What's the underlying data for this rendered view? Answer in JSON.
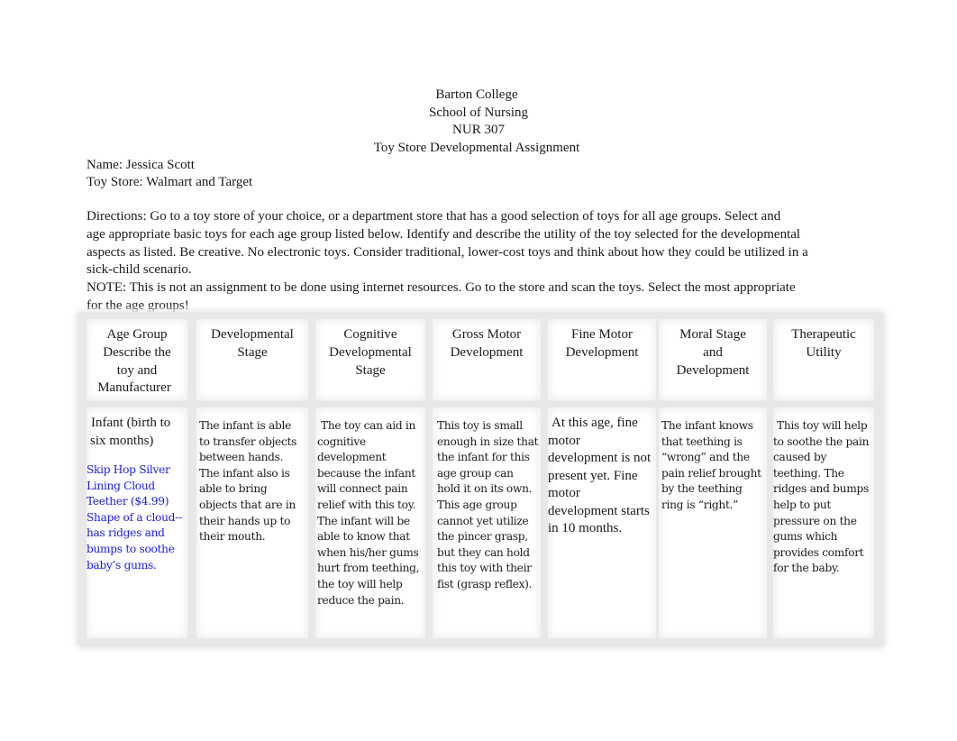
{
  "header": {
    "institution": "Barton College",
    "school": "School of Nursing",
    "course": "NUR 307",
    "assignment_title": "Toy Store Developmental Assignment"
  },
  "meta": {
    "name": "Name: Jessica Scott",
    "toy_store": "Toy Store: Walmart and Target"
  },
  "directions": {
    "line1": "Directions: Go to a toy store of your choice, or a department store that has a good selection of toys for all age groups. Select and",
    "line2": "age appropriate basic toys for each age group listed below. Identify and describe the utility of the toy selected for the developmental",
    "line3": "aspects as listed. Be creative. No electronic toys. Consider traditional, lower-cost toys and think about how they could be utilized in a",
    "line4": "sick-child scenario.",
    "note1": "NOTE: This is not an assignment to be done using internet resources. Go to the store and scan the toys. Select the most appropriate",
    "note2": "for the age groups!"
  },
  "table": {
    "headers": [
      "Age Group Describe the toy and Manufacturer",
      "Developmental Stage",
      "Cognitive Developmental Stage",
      "Gross Motor Development",
      "Fine Motor Development",
      "Moral Stage and Development",
      "Therapeutic Utility"
    ],
    "header_lines": [
      [
        "Age Group",
        "Describe the",
        "toy and",
        "Manufacturer"
      ],
      [
        "Developmental",
        "Stage"
      ],
      [
        "Cognitive",
        "Developmental",
        "Stage"
      ],
      [
        "Gross Motor",
        "Development"
      ],
      [
        "Fine Motor",
        "Development"
      ],
      [
        "Moral Stage",
        "and",
        "Development"
      ],
      [
        "Therapeutic",
        "Utility"
      ]
    ],
    "rows": [
      {
        "age_group": "Infant (birth to six months)",
        "toy_description": "Skip Hop Silver Lining Cloud Teether   ($4.99) Shape of a cloud--has ridges and bumps to soothe baby’s gums.",
        "developmental_stage": "The infant is able to transfer objects between hands. The infant also is able to bring objects that are in their hands up to their mouth.",
        "cognitive": "The toy can aid in cognitive development because the infant will connect pain relief with this toy. The infant will be able to know that when his/her gums hurt from teething, the toy will help reduce the pain.",
        "gross_motor": "This toy is small enough in size that the infant for this age group can hold it on its own. This age group cannot yet utilize the pincer grasp, but they can hold this toy with their fist (grasp reflex).",
        "fine_motor": "At this age, fine motor development is not present yet. Fine motor development starts in 10 months.",
        "moral": "The infant knows that teething is “wrong” and the pain relief brought by the teething ring is “right.”",
        "therapeutic": "This toy will help to soothe the pain caused by teething. The ridges and bumps help to put pressure on the gums which provides comfort for the baby."
      }
    ]
  },
  "colors": {
    "toy_text": "#1c1cdb",
    "body_text": "#1a1a1a"
  }
}
